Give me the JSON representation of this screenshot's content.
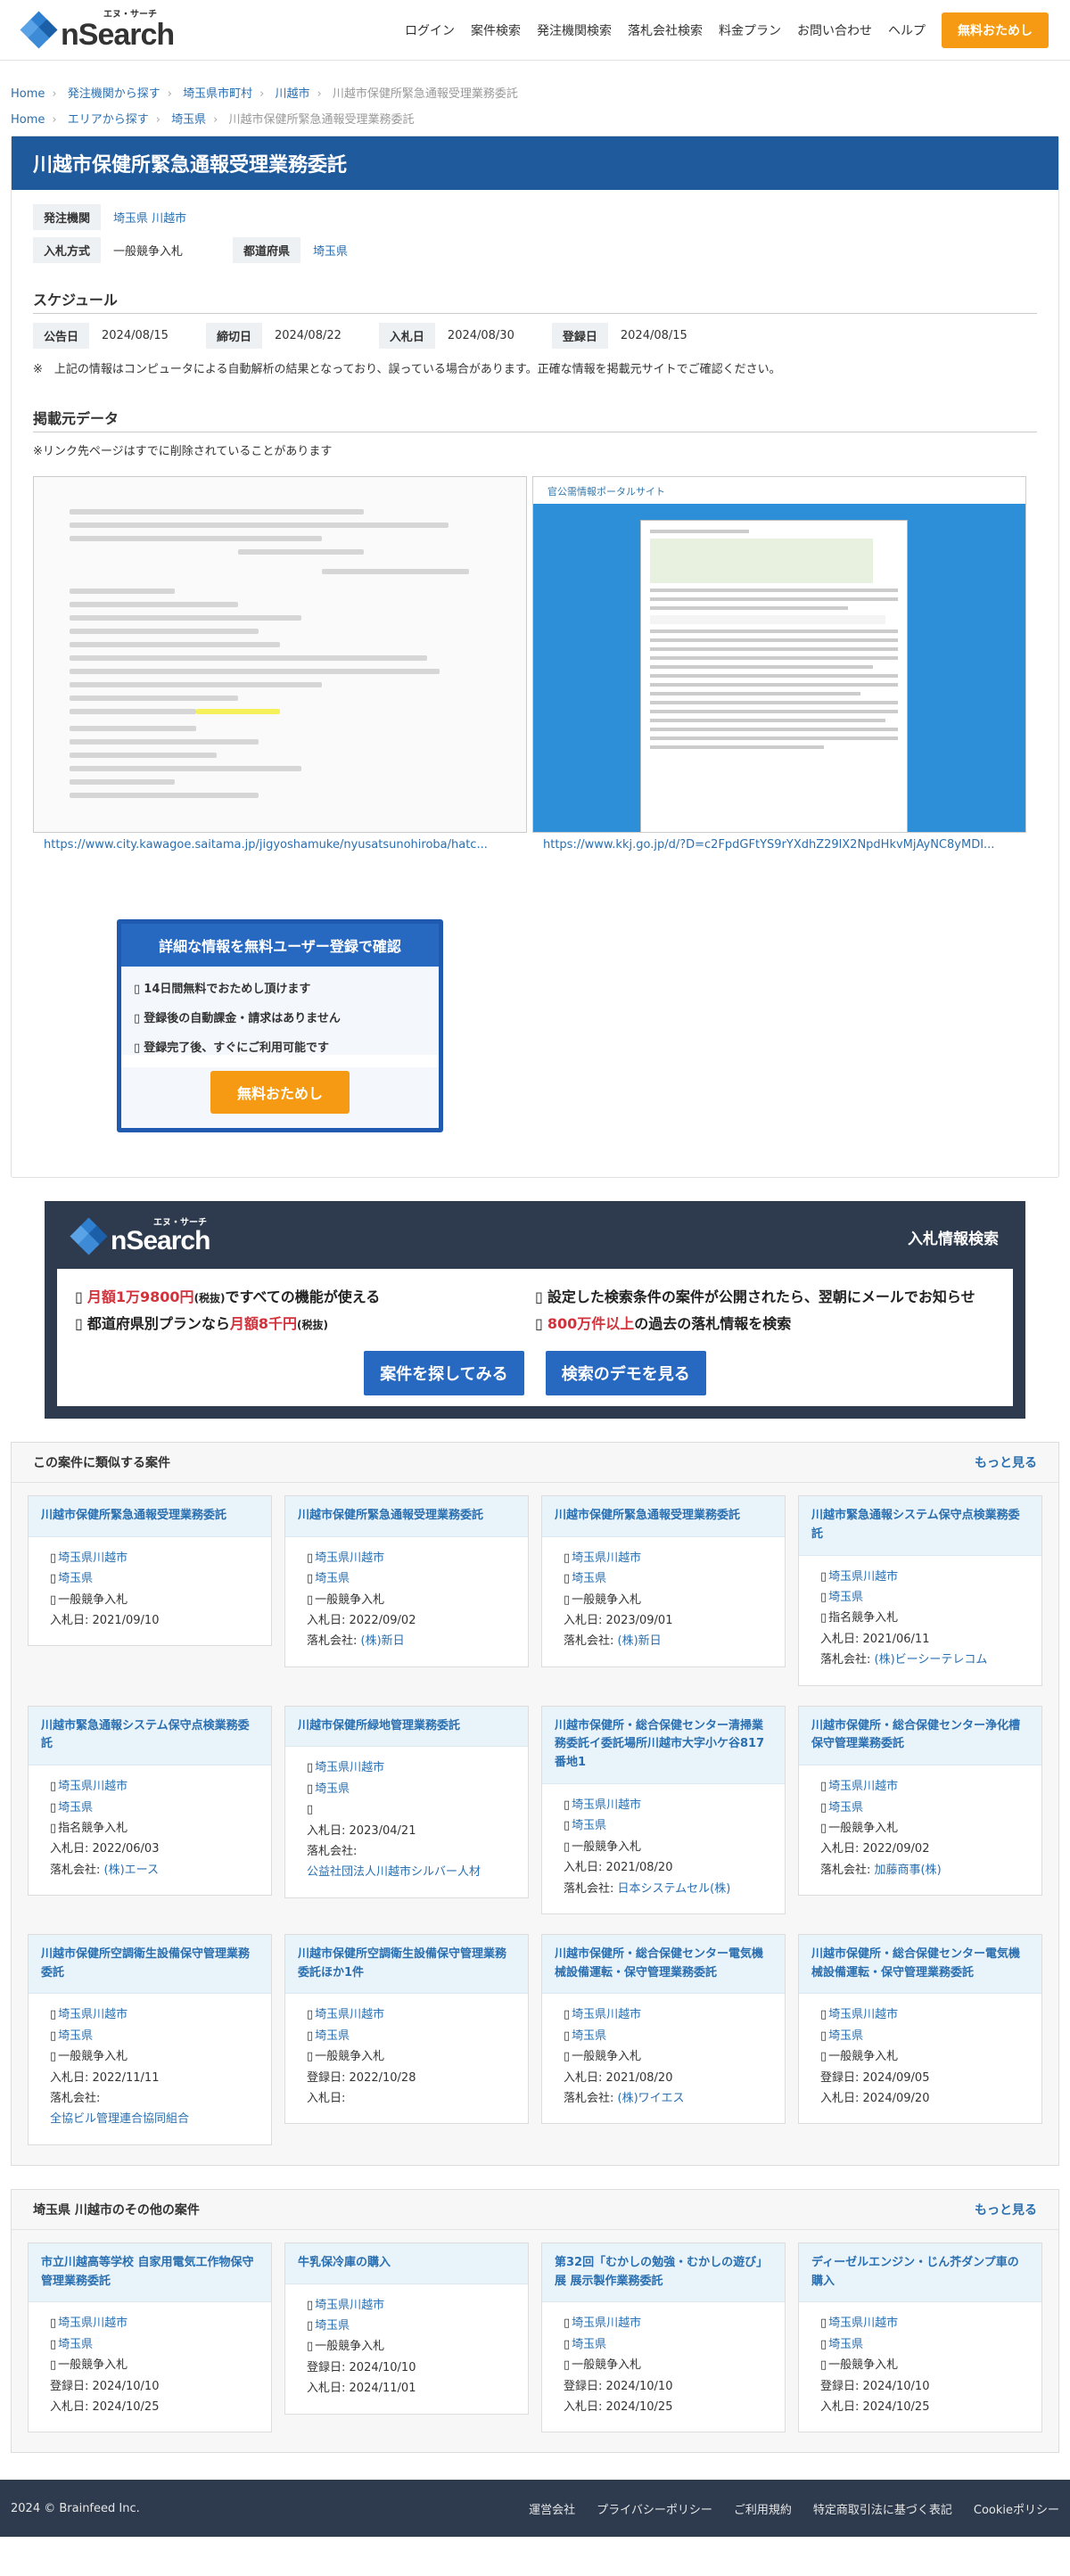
{
  "header": {
    "logo_kana": "エヌ・サーチ",
    "logo_text": "nSearch",
    "nav": [
      "ログイン",
      "案件検索",
      "発注機関検索",
      "落札会社検索",
      "料金プラン",
      "お問い合わせ",
      "ヘルプ"
    ],
    "cta": "無料おためし"
  },
  "breadcrumbs": [
    [
      "Home",
      "発注機関から探す",
      "埼玉県市町村",
      "川越市",
      "川越市保健所緊急通報受理業務委託"
    ],
    [
      "Home",
      "エリアから探す",
      "埼玉県",
      "川越市保健所緊急通報受理業務委託"
    ]
  ],
  "detail": {
    "title": "川越市保健所緊急通報受理業務委託",
    "orderer_label": "発注機関",
    "orderer_pref": "埼玉県",
    "orderer_city": "川越市",
    "method_label": "入札方式",
    "method": "一般競争入札",
    "pref_label": "都道府県",
    "pref": "埼玉県",
    "schedule_heading": "スケジュール",
    "schedule": [
      {
        "label": "公告日",
        "value": "2024/08/15"
      },
      {
        "label": "締切日",
        "value": "2024/08/22"
      },
      {
        "label": "入札日",
        "value": "2024/08/30"
      },
      {
        "label": "登録日",
        "value": "2024/08/15"
      }
    ],
    "disclaimer": "※　上記の情報はコンピュータによる自動解析の結果となっており、誤っている場合があります。正確な情報を掲載元サイトでご確認ください。",
    "source_heading": "掲載元データ",
    "source_note": "※リンク先ページはすでに削除されていることがあります",
    "source_url_1": "https://www.city.kawagoe.saitama.jp/jigyoshamuke/nyusatsunohiroba/hatc...",
    "source_url_2": "https://www.kkj.go.jp/d/?D=c2FpdGFtYS9rYXdhZ29lX2NpdHkvMjAyNC8yMDI...",
    "preview_site": "官公需情報ポータルサイト"
  },
  "signup": {
    "heading": "詳細な情報を無料ユーザー登録で確認",
    "items": [
      "14日間無料でおためし頂けます",
      "登録後の自動課金・請求はありません",
      "登録完了後、すぐにご利用可能です"
    ],
    "button": "無料おためし"
  },
  "promo": {
    "title": "入札情報検索",
    "f1a": "月額1万9800円",
    "f1b": "(税抜)",
    "f1c": "ですべての機能が使える",
    "f2": "設定した検索条件の案件が公開されたら、翌朝にメールでお知らせ",
    "f3a": "都道府県別プランなら",
    "f3b": "月額8千円",
    "f3c": "(税抜)",
    "f4a": "800万件以上",
    "f4b": "の過去の落札情報を検索",
    "btn1": "案件を探してみる",
    "btn2": "検索のデモを見る"
  },
  "similar": {
    "heading": "この案件に類似する案件",
    "more": "もっと見る",
    "items": [
      {
        "title": "川越市保健所緊急通報受理業務委託",
        "city": "埼玉県川越市",
        "pref": "埼玉県",
        "method": "一般競争入札",
        "d1l": "入札日:",
        "d1": "2021/09/10"
      },
      {
        "title": "川越市保健所緊急通報受理業務委託",
        "city": "埼玉県川越市",
        "pref": "埼玉県",
        "method": "一般競争入札",
        "d1l": "入札日:",
        "d1": "2022/09/02",
        "wl": "落札会社:",
        "w": "(株)新日"
      },
      {
        "title": "川越市保健所緊急通報受理業務委託",
        "city": "埼玉県川越市",
        "pref": "埼玉県",
        "method": "一般競争入札",
        "d1l": "入札日:",
        "d1": "2023/09/01",
        "wl": "落札会社:",
        "w": "(株)新日"
      },
      {
        "title": "川越市緊急通報システム保守点検業務委託",
        "city": "埼玉県川越市",
        "pref": "埼玉県",
        "method": "指名競争入札",
        "d1l": "入札日:",
        "d1": "2021/06/11",
        "wl": "落札会社:",
        "w": "(株)ビーシーテレコム"
      },
      {
        "title": "川越市緊急通報システム保守点検業務委託",
        "city": "埼玉県川越市",
        "pref": "埼玉県",
        "method": "指名競争入札",
        "d1l": "入札日:",
        "d1": "2022/06/03",
        "wl": "落札会社:",
        "w": "(株)エース"
      },
      {
        "title": "川越市保健所緑地管理業務委託",
        "city": "埼玉県川越市",
        "pref": "埼玉県",
        "method": "",
        "d1l": "入札日:",
        "d1": "2023/04/21",
        "wl": "落札会社:",
        "w": "公益社団法人川越市シルバー人材",
        "wblock": true
      },
      {
        "title": "川越市保健所・総合保健センター清掃業務委託イ委託場所川越市大字小ケ谷817番地1",
        "city": "埼玉県川越市",
        "pref": "埼玉県",
        "method": "一般競争入札",
        "d1l": "入札日:",
        "d1": "2021/08/20",
        "wl": "落札会社:",
        "w": "日本システムセル(株)"
      },
      {
        "title": "川越市保健所・総合保健センター浄化槽保守管理業務委託",
        "city": "埼玉県川越市",
        "pref": "埼玉県",
        "method": "一般競争入札",
        "d1l": "入札日:",
        "d1": "2022/09/02",
        "wl": "落札会社:",
        "w": "加藤商事(株)"
      },
      {
        "title": "川越市保健所空調衛生設備保守管理業務委託",
        "city": "埼玉県川越市",
        "pref": "埼玉県",
        "method": "一般競争入札",
        "d1l": "入札日:",
        "d1": "2022/11/11",
        "wl": "落札会社:",
        "w": "全協ビル管理連合協同組合",
        "wblock": true
      },
      {
        "title": "川越市保健所空調衛生設備保守管理業務委託ほか1件",
        "city": "埼玉県川越市",
        "pref": "埼玉県",
        "method": "一般競争入札",
        "d1l": "登録日:",
        "d1": "2022/10/28",
        "d2l": "入札日:",
        "d2": ""
      },
      {
        "title": "川越市保健所・総合保健センター電気機械設備運転・保守管理業務委託",
        "city": "埼玉県川越市",
        "pref": "埼玉県",
        "method": "一般競争入札",
        "d1l": "入札日:",
        "d1": "2021/08/20",
        "wl": "落札会社:",
        "w": "(株)ワイエス"
      },
      {
        "title": "川越市保健所・総合保健センター電気機械設備運転・保守管理業務委託",
        "city": "埼玉県川越市",
        "pref": "埼玉県",
        "method": "一般競争入札",
        "d1l": "登録日:",
        "d1": "2024/09/05",
        "d2l": "入札日:",
        "d2": "2024/09/20"
      }
    ]
  },
  "others": {
    "heading": "埼玉県 川越市のその他の案件",
    "more": "もっと見る",
    "items": [
      {
        "title": "市立川越高等学校 自家用電気工作物保守管理業務委託",
        "city": "埼玉県川越市",
        "pref": "埼玉県",
        "method": "一般競争入札",
        "d1l": "登録日:",
        "d1": "2024/10/10",
        "d2l": "入札日:",
        "d2": "2024/10/25"
      },
      {
        "title": "牛乳保冷庫の購入",
        "city": "埼玉県川越市",
        "pref": "埼玉県",
        "method": "一般競争入札",
        "d1l": "登録日:",
        "d1": "2024/10/10",
        "d2l": "入札日:",
        "d2": "2024/11/01"
      },
      {
        "title": "第32回「むかしの勉強・むかしの遊び」展 展示製作業務委託",
        "city": "埼玉県川越市",
        "pref": "埼玉県",
        "method": "一般競争入札",
        "d1l": "登録日:",
        "d1": "2024/10/10",
        "d2l": "入札日:",
        "d2": "2024/10/25"
      },
      {
        "title": "ディーゼルエンジン・じん芥ダンプ車の購入",
        "city": "埼玉県川越市",
        "pref": "埼玉県",
        "method": "一般競争入札",
        "d1l": "登録日:",
        "d1": "2024/10/10",
        "d2l": "入札日:",
        "d2": "2024/10/25"
      }
    ]
  },
  "footer": {
    "copyright": "2024 © Brainfeed Inc.",
    "links": [
      "運営会社",
      "プライバシーポリシー",
      "ご利用規約",
      "特定商取引法に基づく表記",
      "Cookieポリシー"
    ]
  }
}
